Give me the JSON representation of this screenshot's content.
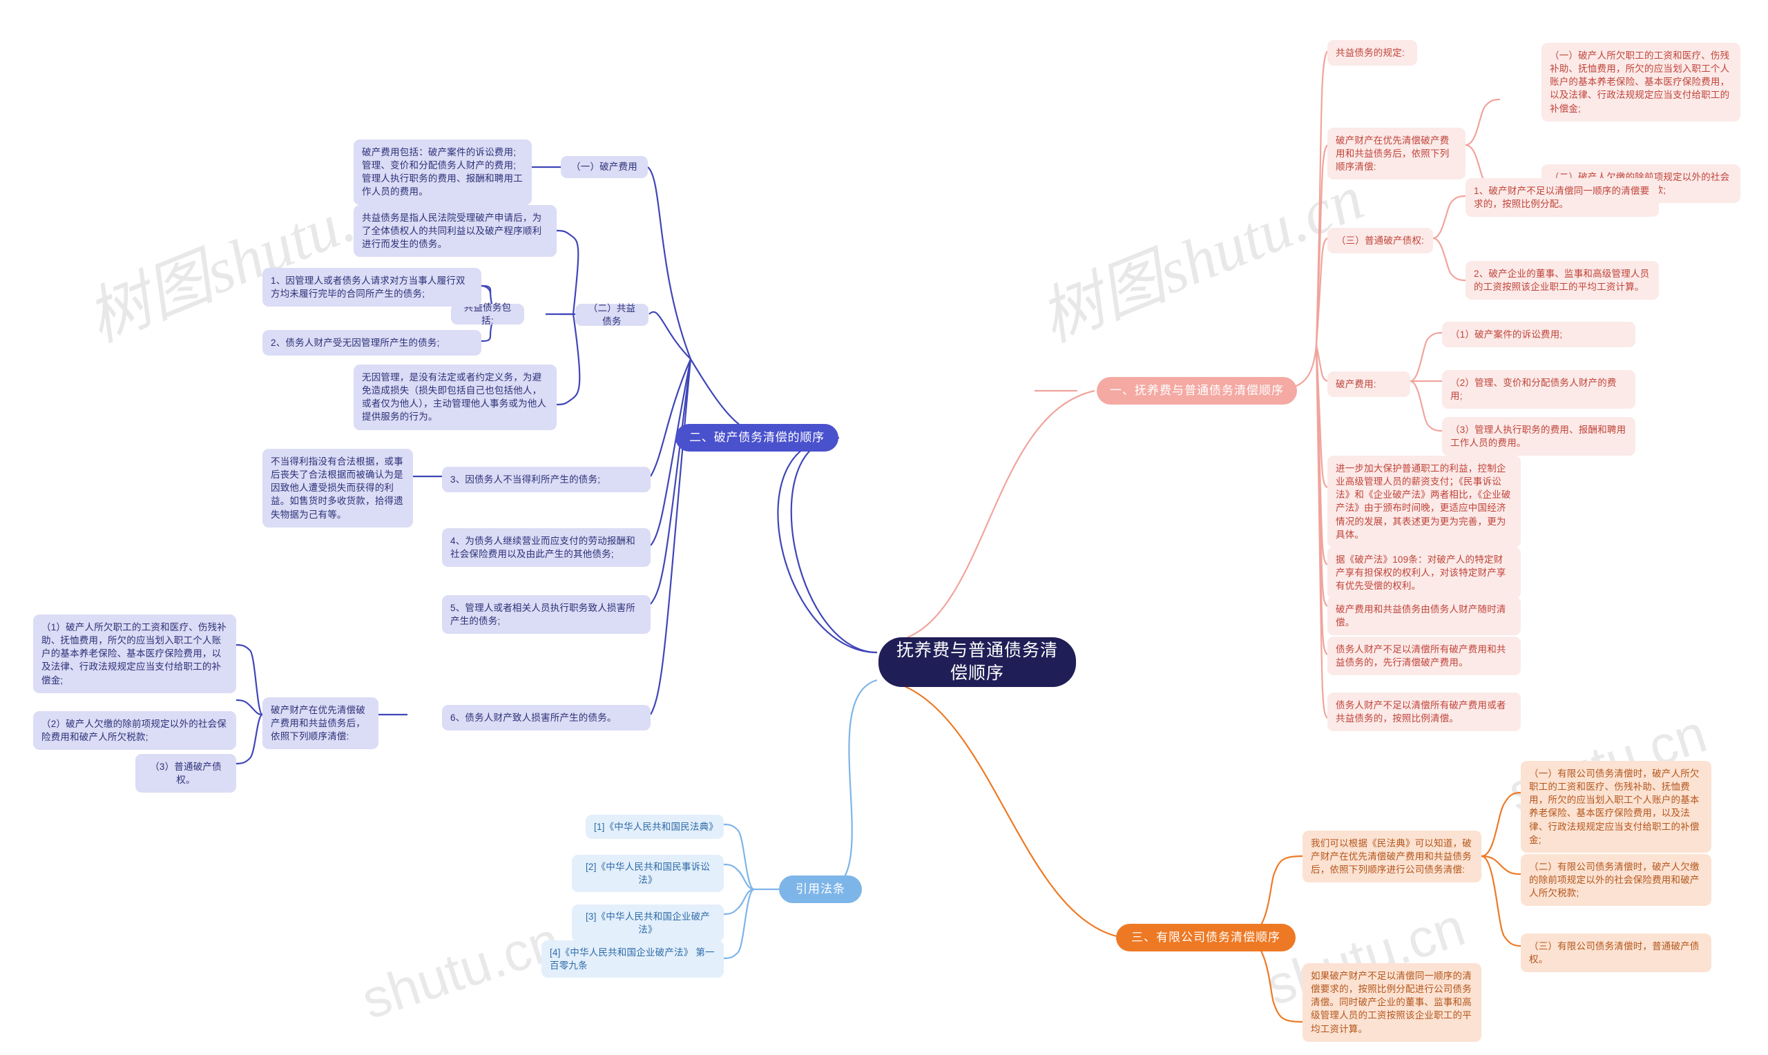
{
  "root": {
    "label": "抚养费与普通债务清偿顺序"
  },
  "watermarks": [
    {
      "text": "树图shutu.cn"
    },
    {
      "text": "树图shutu.cn"
    },
    {
      "text": "shutu.cn"
    },
    {
      "text": "shutu.cn"
    },
    {
      "text": "shutu.cn"
    }
  ],
  "branches": {
    "bankruptcy_order": {
      "label": "二、破产债务清偿的顺序",
      "children": [
        {
          "label": "（一）破产费用",
          "detail": "破产费用包括：破产案件的诉讼费用;管理、变价和分配债务人财产的费用;管理人执行职务的费用、报酬和聘用工作人员的费用。"
        },
        {
          "label": "（二）共益债务",
          "intro": "共益债务是指人民法院受理破产申请后，为了全体债权人的共同利益以及破产程序顺利进行而发生的债务。",
          "group_label": "共益债务包括:",
          "items": [
            "1、因管理人或者债务人请求对方当事人履行双方均未履行完毕的合同所产生的债务;",
            "2、债务人财产受无因管理所产生的债务;"
          ],
          "item_detail": "无因管理，是没有法定或者约定义务，为避免造成损失（损失即包括自己也包括他人，或者仅为他人），主动管理他人事务或为他人提供服务的行为。",
          "items2": [
            {
              "label": "3、因债务人不当得利所产生的债务;",
              "detail": "不当得利指没有合法根据，或事后丧失了合法根据而被确认为是因致他人遭受损失而获得的利益。如售货时多收货款，拾得遗失物据为己有等。"
            },
            {
              "label": "4、为债务人继续营业而应支付的劳动报酬和社会保险费用以及由此产生的其他债务;",
              "detail": ""
            },
            {
              "label": "5、管理人或者相关人员执行职务致人损害所产生的债务;",
              "detail": ""
            },
            {
              "label": "6、债务人财产致人损害所产生的债务。",
              "detail": ""
            }
          ]
        }
      ],
      "repay_intro": "破产财产在优先清偿破产费用和共益债务后，依照下列顺序清偿:",
      "repay_items": [
        "（1）破产人所欠职工的工资和医疗、伤残补助、抚恤费用，所欠的应当划入职工个人账户的基本养老保险、基本医疗保险费用，以及法律、行政法规规定应当支付给职工的补偿金;",
        "（2）破产人欠缴的除前项规定以外的社会保险费用和破产人所欠税款;",
        "（3）普通破产债权。"
      ]
    },
    "citations": {
      "label": "引用法条",
      "items": [
        "[1]《中华人民共和国民法典》",
        "[2]《中华人民共和国民事诉讼法》",
        "[3]《中华人民共和国企业破产法》",
        "[4]《中华人民共和国企业破产法》 第一百零九条"
      ]
    },
    "alimony_order": {
      "label": "一、抚养费与普通债务清偿顺序",
      "public_debt_label": "共益债务的规定:",
      "repay_intro": "破产财产在优先清偿破产费用和共益债务后，依照下列顺序清偿:",
      "repay_items": [
        "（一）破产人所欠职工的工资和医疗、伤残补助、抚恤费用，所欠的应当划入职工个人账户的基本养老保险、基本医疗保险费用，以及法律、行政法规规定应当支付给职工的补偿金;",
        "（二）破产人欠缴的除前项规定以外的社会保险费用和破产人所欠税款;"
      ],
      "ordinary_claim_label": "（三）普通破产债权:",
      "ordinary_claim_items": [
        "1、破产财产不足以清偿同一顺序的清偿要求的，按照比例分配。",
        "2、破产企业的董事、监事和高级管理人员的工资按照该企业职工的平均工资计算。"
      ],
      "fee_label": "破产费用:",
      "fee_items": [
        "（1）破产案件的诉讼费用;",
        "（2）管理、变价和分配债务人财产的费用;",
        "（3）管理人执行职务的费用、报酬和聘用工作人员的费用。"
      ],
      "notes": [
        "进一步加大保护普通职工的利益，控制企业高级管理人员的薪资支付；《民事诉讼法》和《企业破产法》两者相比，《企业破产法》由于颁布时间晚，更适应中国经济情况的发展，其表述更为更为完善，更为具体。",
        "据《破产法》109条：对破产人的特定财产享有担保权的权利人，对该特定财产享有优先受偿的权利。",
        "破产费用和共益债务由债务人财产随时清偿。",
        "债务人财产不足以清偿所有破产费用和共益债务的，先行清偿破产费用。",
        "债务人财产不足以清偿所有破产费用或者共益债务的，按照比例清偿。"
      ]
    },
    "company_order": {
      "label": "三、有限公司债务清偿顺序",
      "intro": "我们可以根据《民法典》可以知道，破产财产在优先清偿破产费用和共益债务后，依照下列顺序进行公司债务清偿:",
      "items": [
        "（一）有限公司债务清偿时，破产人所欠职工的工资和医疗、伤残补助、抚恤费用，所欠的应当划入职工个人账户的基本养老保险、基本医疗保险费用，以及法律、行政法规规定应当支付给职工的补偿金;",
        "（二）有限公司债务清偿时，破产人欠缴的除前项规定以外的社会保险费用和破产人所欠税款;",
        "（三）有限公司债务清偿时，普通破产债权。"
      ],
      "outro": "如果破产财产不足以清偿同一顺序的清偿要求的，按照比例分配进行公司债务清偿。同时破产企业的董事、监事和高级管理人员的工资按照该企业职工的平均工资计算。"
    }
  },
  "colors": {
    "root_bg": "#201e56",
    "blue": "#4a51cd",
    "blue_light": "#dbdcf5",
    "lightblue": "#7db5e8",
    "lightblue_light": "#e3effb",
    "pink": "#f4a9a3",
    "pink_light": "#fbeae8",
    "orange": "#ee7924",
    "orange_light": "#fbe2d2"
  }
}
